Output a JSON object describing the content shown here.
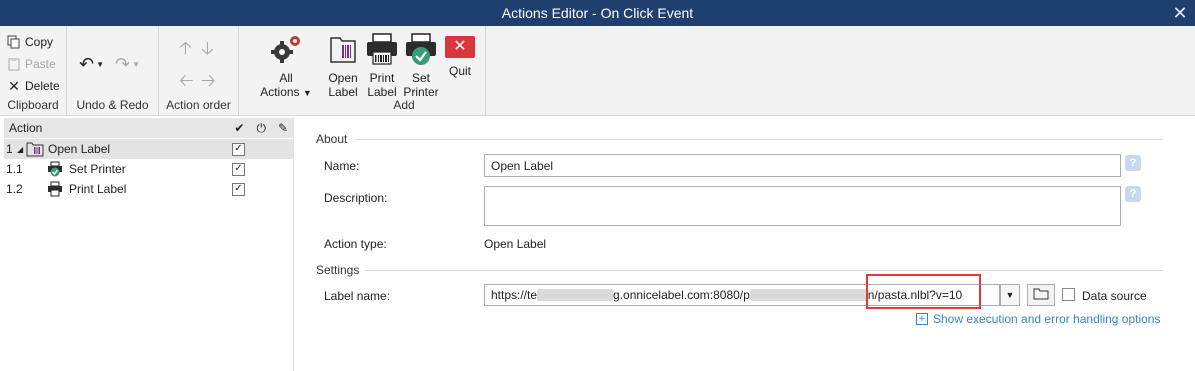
{
  "window": {
    "title": "Actions Editor - On Click Event"
  },
  "ribbon": {
    "clipboard": {
      "copy": "Copy",
      "paste": "Paste",
      "delete": "Delete",
      "label": "Clipboard"
    },
    "undo_redo": {
      "label": "Undo & Redo"
    },
    "action_order": {
      "label": "Action order"
    },
    "all_actions": {
      "line1": "All",
      "line2": "Actions"
    },
    "add": {
      "open_label": [
        "Open",
        "Label"
      ],
      "print_label": [
        "Print",
        "Label"
      ],
      "set_printer": [
        "Set",
        "Printer"
      ],
      "quit": "Quit",
      "label": "Add"
    }
  },
  "tree": {
    "header": "Action",
    "rows": [
      {
        "num": "1",
        "label": "Open Label",
        "checked": true
      },
      {
        "num": "1.1",
        "label": "Set Printer",
        "checked": true
      },
      {
        "num": "1.2",
        "label": "Print Label",
        "checked": true
      }
    ]
  },
  "about": {
    "title": "About",
    "name_label": "Name:",
    "name_value": "Open Label",
    "description_label": "Description:",
    "description_value": "",
    "action_type_label": "Action type:",
    "action_type_value": "Open Label"
  },
  "settings": {
    "title": "Settings",
    "label_name_label": "Label name:",
    "url_part1": "https://te",
    "url_part2": "g.onnicelabel.com:8080/p",
    "url_part3": "n/pasta.nlbl?v=10",
    "data_source": "Data source",
    "show_options": "Show execution and error handling options"
  },
  "colors": {
    "titlebar": "#1f3f6e",
    "highlight": "#e53935",
    "link": "#3b82c4"
  }
}
